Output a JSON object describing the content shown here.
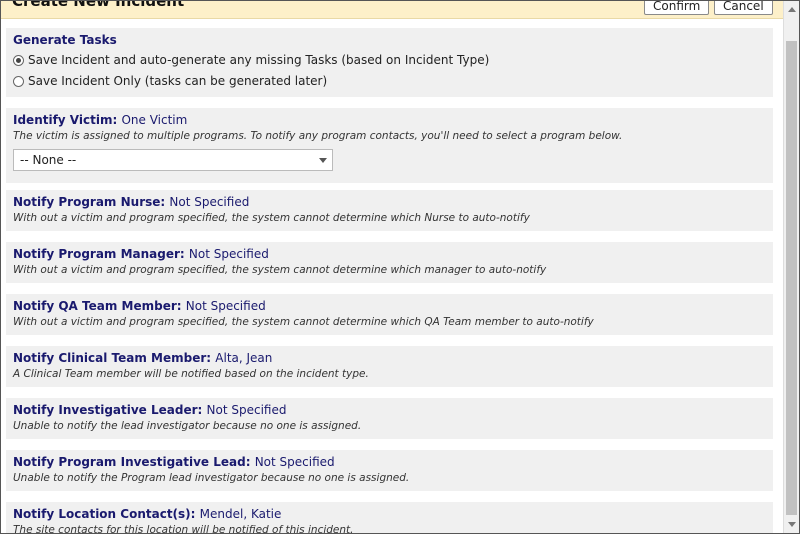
{
  "header": {
    "title": "Create New Incident",
    "confirm_label": "Confirm",
    "cancel_label": "Cancel"
  },
  "generate_tasks": {
    "title": "Generate Tasks",
    "options": [
      {
        "label": "Save Incident and auto-generate any missing Tasks (based on Incident Type)",
        "checked": true
      },
      {
        "label": "Save Incident Only (tasks can be generated later)",
        "checked": false
      }
    ]
  },
  "identify_victim": {
    "title": "Identify Victim:",
    "value": "One Victim",
    "note": "The victim is assigned to multiple programs. To notify any program contacts, you'll need to select a program below.",
    "select_value": "-- None --"
  },
  "notifications": [
    {
      "title": "Notify Program Nurse:",
      "value": "Not Specified",
      "note": "With out a victim and program specified, the system cannot determine which Nurse to auto-notify"
    },
    {
      "title": "Notify Program Manager:",
      "value": "Not Specified",
      "note": "With out a victim and program specified, the system cannot determine which manager to auto-notify"
    },
    {
      "title": "Notify QA Team Member:",
      "value": "Not Specified",
      "note": "With out a victim and program specified, the system cannot determine which QA Team member to auto-notify"
    },
    {
      "title": "Notify Clinical Team Member:",
      "value": "Alta, Jean",
      "note": "A Clinical Team member will be notified based on the incident type."
    },
    {
      "title": "Notify Investigative Leader:",
      "value": "Not Specified",
      "note": "Unable to notify the lead investigator because no one is assigned."
    },
    {
      "title": "Notify Program Investigative Lead:",
      "value": "Not Specified",
      "note": "Unable to notify the Program lead investigator because no one is assigned."
    },
    {
      "title": "Notify Location Contact(s):",
      "value": "Mendel, Katie",
      "note": "The site contacts for this location will be notified of this incident."
    }
  ]
}
